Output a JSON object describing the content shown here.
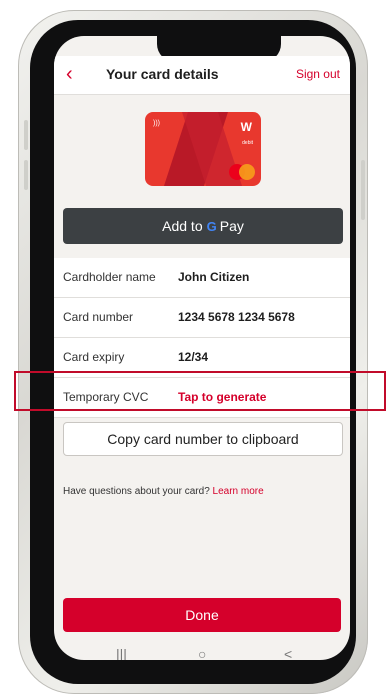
{
  "header": {
    "title": "Your card details",
    "back_icon": "chevron-left-icon",
    "sign_out": "Sign out"
  },
  "card": {
    "brand_text": "W",
    "product": "debit",
    "nfc_icon": "contactless-icon",
    "network": "mastercard-logo"
  },
  "gpay": {
    "prefix": "Add to ",
    "g_mark": "G",
    "suffix": "Pay"
  },
  "details": [
    {
      "label": "Cardholder name",
      "value": "John Citizen"
    },
    {
      "label": "Card number",
      "value": "1234 5678 1234 5678"
    },
    {
      "label": "Card expiry",
      "value": "12/34"
    },
    {
      "label": "Temporary CVC",
      "value": "Tap to generate"
    }
  ],
  "copy_button": "Copy card number to clipboard",
  "help": {
    "text": "Have questions about your card? ",
    "link": "Learn more"
  },
  "done_button": "Done",
  "nav": {
    "recents_icon": "|||",
    "home_icon": "○",
    "back_icon": "<"
  },
  "colors": {
    "accent": "#d5002b",
    "button_dark": "#3c4043",
    "highlight": "#c10b2a"
  }
}
